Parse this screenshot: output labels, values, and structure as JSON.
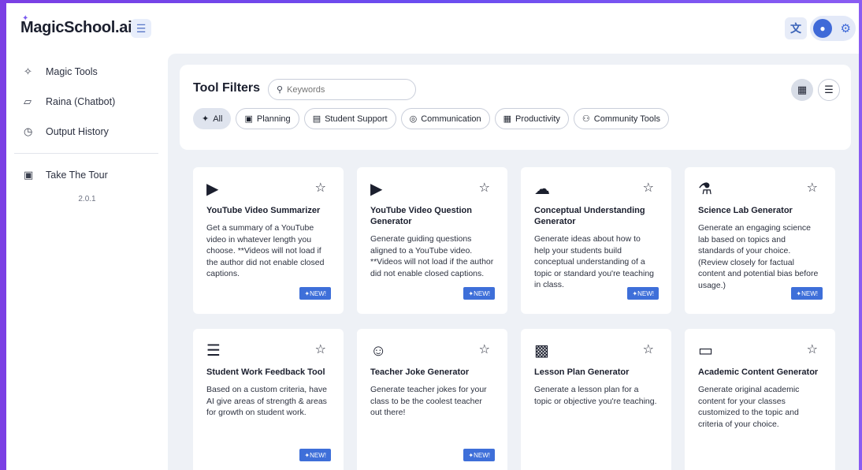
{
  "header": {
    "logo_text": "MagicSchool.ai",
    "menu_icon": "hamburger-icon",
    "translate_icon": "translate-icon",
    "avatar_icon": "user-icon",
    "settings_icon": "gear-icon"
  },
  "sidebar": {
    "items": [
      {
        "label": "Magic Tools",
        "icon": "sparkle-icon"
      },
      {
        "label": "Raina (Chatbot)",
        "icon": "chat-icon"
      },
      {
        "label": "Output History",
        "icon": "history-icon"
      }
    ],
    "tour_label": "Take The Tour",
    "version": "2.0.1"
  },
  "filters": {
    "title": "Tool Filters",
    "search_placeholder": "Keywords",
    "chips": [
      {
        "label": "All",
        "icon": "✦"
      },
      {
        "label": "Planning",
        "icon": "▣"
      },
      {
        "label": "Student Support",
        "icon": "▤"
      },
      {
        "label": "Communication",
        "icon": "◎"
      },
      {
        "label": "Productivity",
        "icon": "▦"
      },
      {
        "label": "Community Tools",
        "icon": "⚇"
      }
    ]
  },
  "cards": [
    {
      "icon": "▶",
      "title": "YouTube Video Summarizer",
      "desc": "Get a summary of a YouTube video in whatever length you choose. **Videos will not load if the author did not enable closed captions.",
      "badge": "✦NEW!"
    },
    {
      "icon": "▶",
      "title": "YouTube Video Question Generator",
      "desc": "Generate guiding questions aligned to a YouTube video. **Videos will not load if the author did not enable closed captions.",
      "badge": "✦NEW!"
    },
    {
      "icon": "☁",
      "title": "Conceptual Understanding Generator",
      "desc": "Generate ideas about how to help your students build conceptual understanding of a topic or standard you're teaching in class.",
      "badge": "✦NEW!"
    },
    {
      "icon": "⚗",
      "title": "Science Lab Generator",
      "desc": "Generate an engaging science lab based on topics and standards of your choice. (Review closely for factual content and potential bias before usage.)",
      "badge": "✦NEW!"
    },
    {
      "icon": "☰",
      "title": "Student Work Feedback Tool",
      "desc": "Based on a custom criteria, have AI give areas of strength & areas for growth on student work.",
      "badge": "✦NEW!"
    },
    {
      "icon": "☺",
      "title": "Teacher Joke Generator",
      "desc": "Generate teacher jokes for your class to be the coolest teacher out there!",
      "badge": "✦NEW!"
    },
    {
      "icon": "▩",
      "title": "Lesson Plan Generator",
      "desc": "Generate a lesson plan for a topic or objective you're teaching.",
      "badge": ""
    },
    {
      "icon": "▭",
      "title": "Academic Content Generator",
      "desc": "Generate original academic content for your classes customized to the topic and criteria of your choice.",
      "badge": ""
    }
  ]
}
